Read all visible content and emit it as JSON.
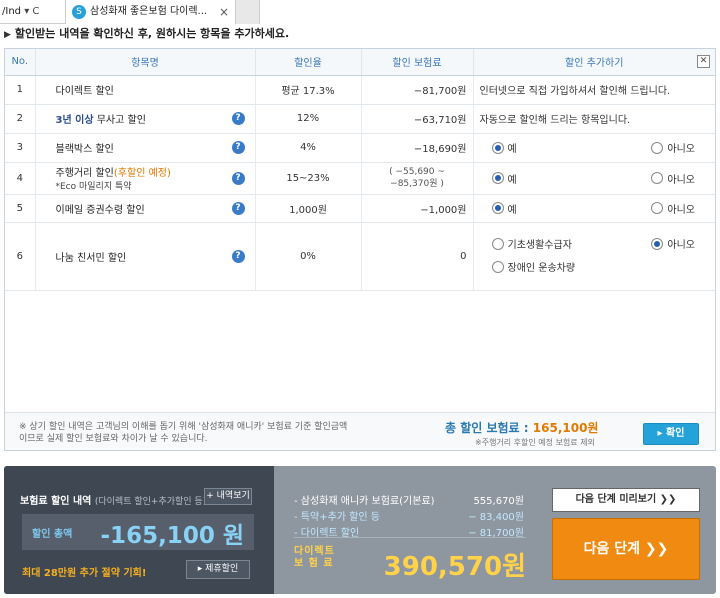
{
  "browser": {
    "address_fragment": "/Ind",
    "address_suffix": "▾ C",
    "tab_title": "삼성화재 좋은보험 다이렉...",
    "tab_close": "×"
  },
  "headline": "할인받는 내역을 확인하신 후, 원하시는 항목을 추가하세요.",
  "table": {
    "headers": {
      "no": "No.",
      "name": "항목명",
      "rate": "할인율",
      "amount": "할인 보험료",
      "add": "할인 추가하기"
    },
    "rows": [
      {
        "no": "1",
        "name": "다이렉트 할인",
        "rate": "평균 17.3%",
        "amount": "−81,700원",
        "desc": "인터넷으로 직접 가입하셔서 할인해 드립니다."
      },
      {
        "no": "2",
        "name": "3년 이상 무사고 할인",
        "name_bold": "3년 이상",
        "name_rest": " 무사고 할인",
        "rate": "12%",
        "amount": "−63,710원",
        "desc": "자동으로 할인해 드리는 항목입니다."
      },
      {
        "no": "3",
        "name": "블랙박스 할인",
        "rate": "4%",
        "amount": "−18,690원",
        "opt_yes": "예",
        "opt_no": "아니오"
      },
      {
        "no": "4",
        "name_main": "주행거리 할인",
        "name_orange": "(후할인 예정)",
        "name_sub": "*Eco 마일리지 특약",
        "rate": "15~23%",
        "amount_line1": "( −55,690 ~",
        "amount_line2": "−85,370원 )",
        "opt_yes": "예",
        "opt_no": "아니오"
      },
      {
        "no": "5",
        "name": "이메일 증권수령 할인",
        "rate": "1,000원",
        "amount": "−1,000원",
        "opt_yes": "예",
        "opt_no": "아니오"
      },
      {
        "no": "6",
        "name": "나눔 친서민 할인",
        "rate": "0%",
        "amount": "0",
        "opt_a": "기초생활수급자",
        "opt_b": "장애인 운송차량",
        "opt_no": "아니오"
      }
    ]
  },
  "note": "※ 상기 할인 내역은 고객님의 이해를 돕기 위해 '삼성화재 애니카' 보험료 기준 할인금액이므로 실제 할인 보험료와 차이가 날 수 있습니다.",
  "total": {
    "label": "총 할인 보험료 : ",
    "value": "165,100원",
    "sub": "※주행거리 후할인 예정 보험료 제외"
  },
  "confirm_label": "확인",
  "summary": {
    "title": "보험료 할인 내역",
    "title_sub": "(다이렉트 할인+추가할인 등)",
    "detail_btn": "+ 내역보기",
    "disc_label": "할인 총액",
    "disc_value": "-165,100 원",
    "save_text": "최대 28만원 추가 절약 기회!",
    "partner_btn": "제휴할인",
    "base_label": "삼성화재 애니카 보험료(기본료)",
    "base_value": "555,670원",
    "extra_label": "특약+추가 할인 등",
    "extra_value": "− 83,400원",
    "direct_disc_label": "다이렉트 할인",
    "direct_disc_value": "− 81,700원",
    "direct_label_1": "다이렉트",
    "direct_label_2": "보 험 료",
    "direct_value": "390,570원",
    "preview_btn": "다음 단계 미리보기  ❯❯",
    "next_btn": "다음 단계  ❯❯"
  }
}
